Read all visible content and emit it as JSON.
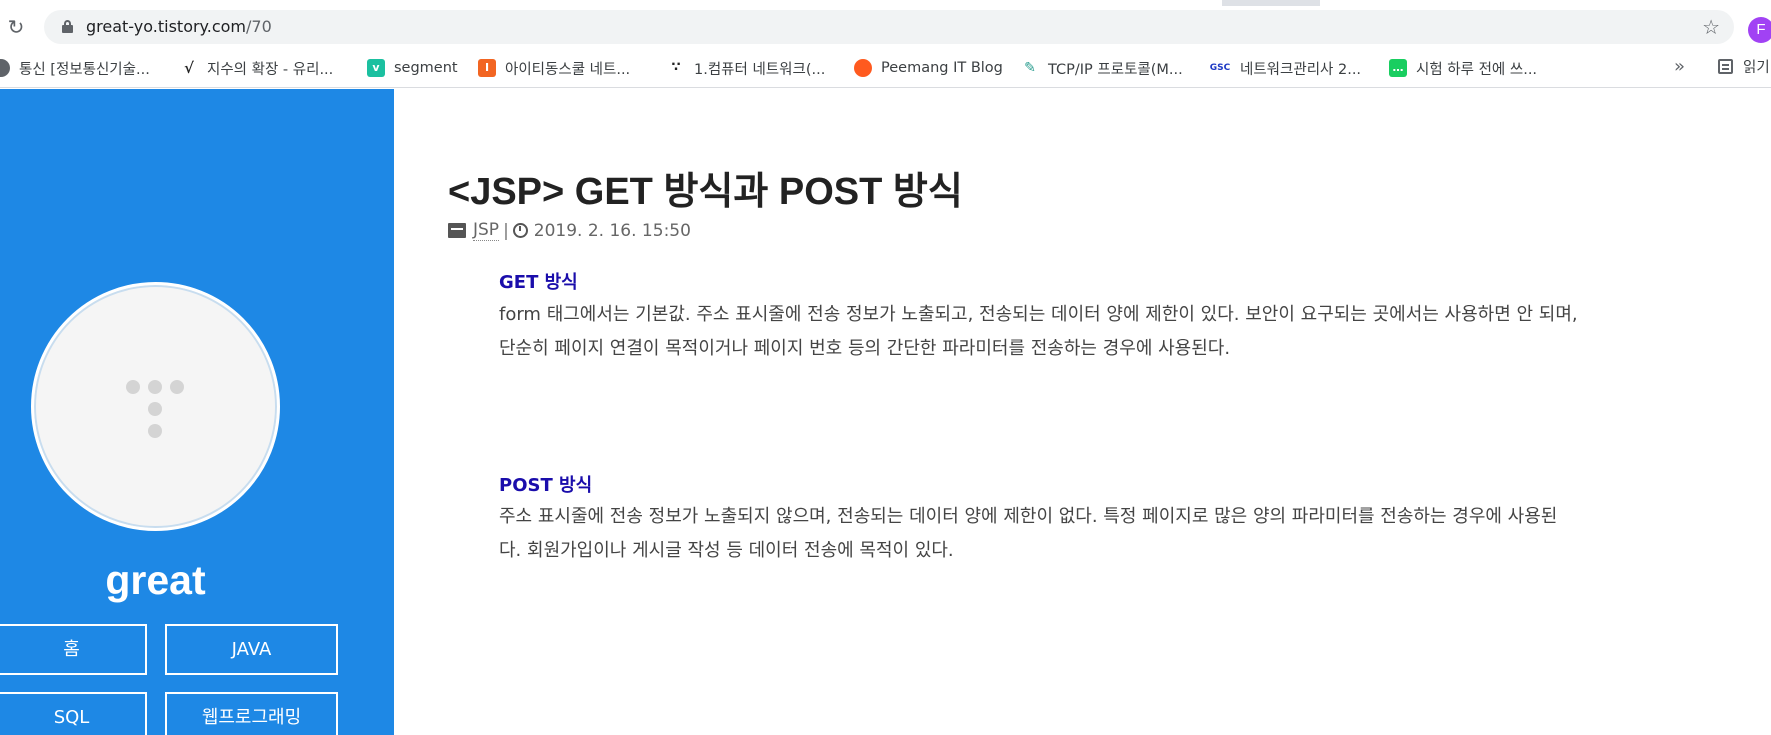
{
  "browser": {
    "url_host": "great-yo.tistory.com",
    "url_path": "/70",
    "profile_initial": "F"
  },
  "bookmarks": [
    {
      "label": "통신 [정보통신기술...",
      "icon": "globe-icon",
      "color": "#5f6368"
    },
    {
      "label": "지수의 확장 - 유리...",
      "icon": "sqrt-icon",
      "color": "#222222"
    },
    {
      "label": "segment",
      "icon": "v-icon",
      "color": "#1bc0a0"
    },
    {
      "label": "아이티동스쿨 네트...",
      "icon": "it-school-icon",
      "color": "#f26522"
    },
    {
      "label": "1.컴퓨터 네트워크(...",
      "icon": "dots-icon",
      "color": "#222222"
    },
    {
      "label": "Peemang IT Blog",
      "icon": "peemang-icon",
      "color": "#ff5a1f"
    },
    {
      "label": "TCP/IP 프로토콜(M...",
      "icon": "pen-icon",
      "color": "#2a9d8f"
    },
    {
      "label": "네트워크관리사 2...",
      "icon": "gsc-icon",
      "color": "#1d39c4"
    },
    {
      "label": "시험 하루 전에 쓰...",
      "icon": "chat-icon",
      "color": "#19ce60"
    }
  ],
  "bookmarks_more": "»",
  "reading_list": "읽기",
  "sidebar": {
    "blog_name": "great",
    "nav": [
      "홈",
      "JAVA",
      "SQL",
      "웹프로그래밍"
    ],
    "bg_color": "#1e88e5"
  },
  "post": {
    "title": "<JSP> GET 방식과 POST 방식",
    "category": "JSP",
    "separator": "|",
    "date": "2019. 2. 16. 15:50",
    "sections": [
      {
        "heading": "GET 방식",
        "lines": [
          "form 태그에서는 기본값. 주소 표시줄에 전송 정보가 노출되고, 전송되는 데이터 양에 제한이 있다. 보안이 요구되는 곳에서는 사용하면 안 되며,",
          "단순히 페이지 연결이 목적이거나 페이지 번호 등의 간단한 파라미터를 전송하는 경우에 사용된다."
        ]
      },
      {
        "heading": "POST 방식",
        "lines": [
          "주소 표시줄에 전송 정보가 노출되지 않으며, 전송되는 데이터 양에 제한이 없다. 특정 페이지로 많은 양의 파라미터를 전송하는 경우에 사용된",
          "다. 회원가입이나 게시글 작성 등 데이터 전송에 목적이 있다."
        ]
      }
    ],
    "heading_color": "#1a0dab"
  }
}
